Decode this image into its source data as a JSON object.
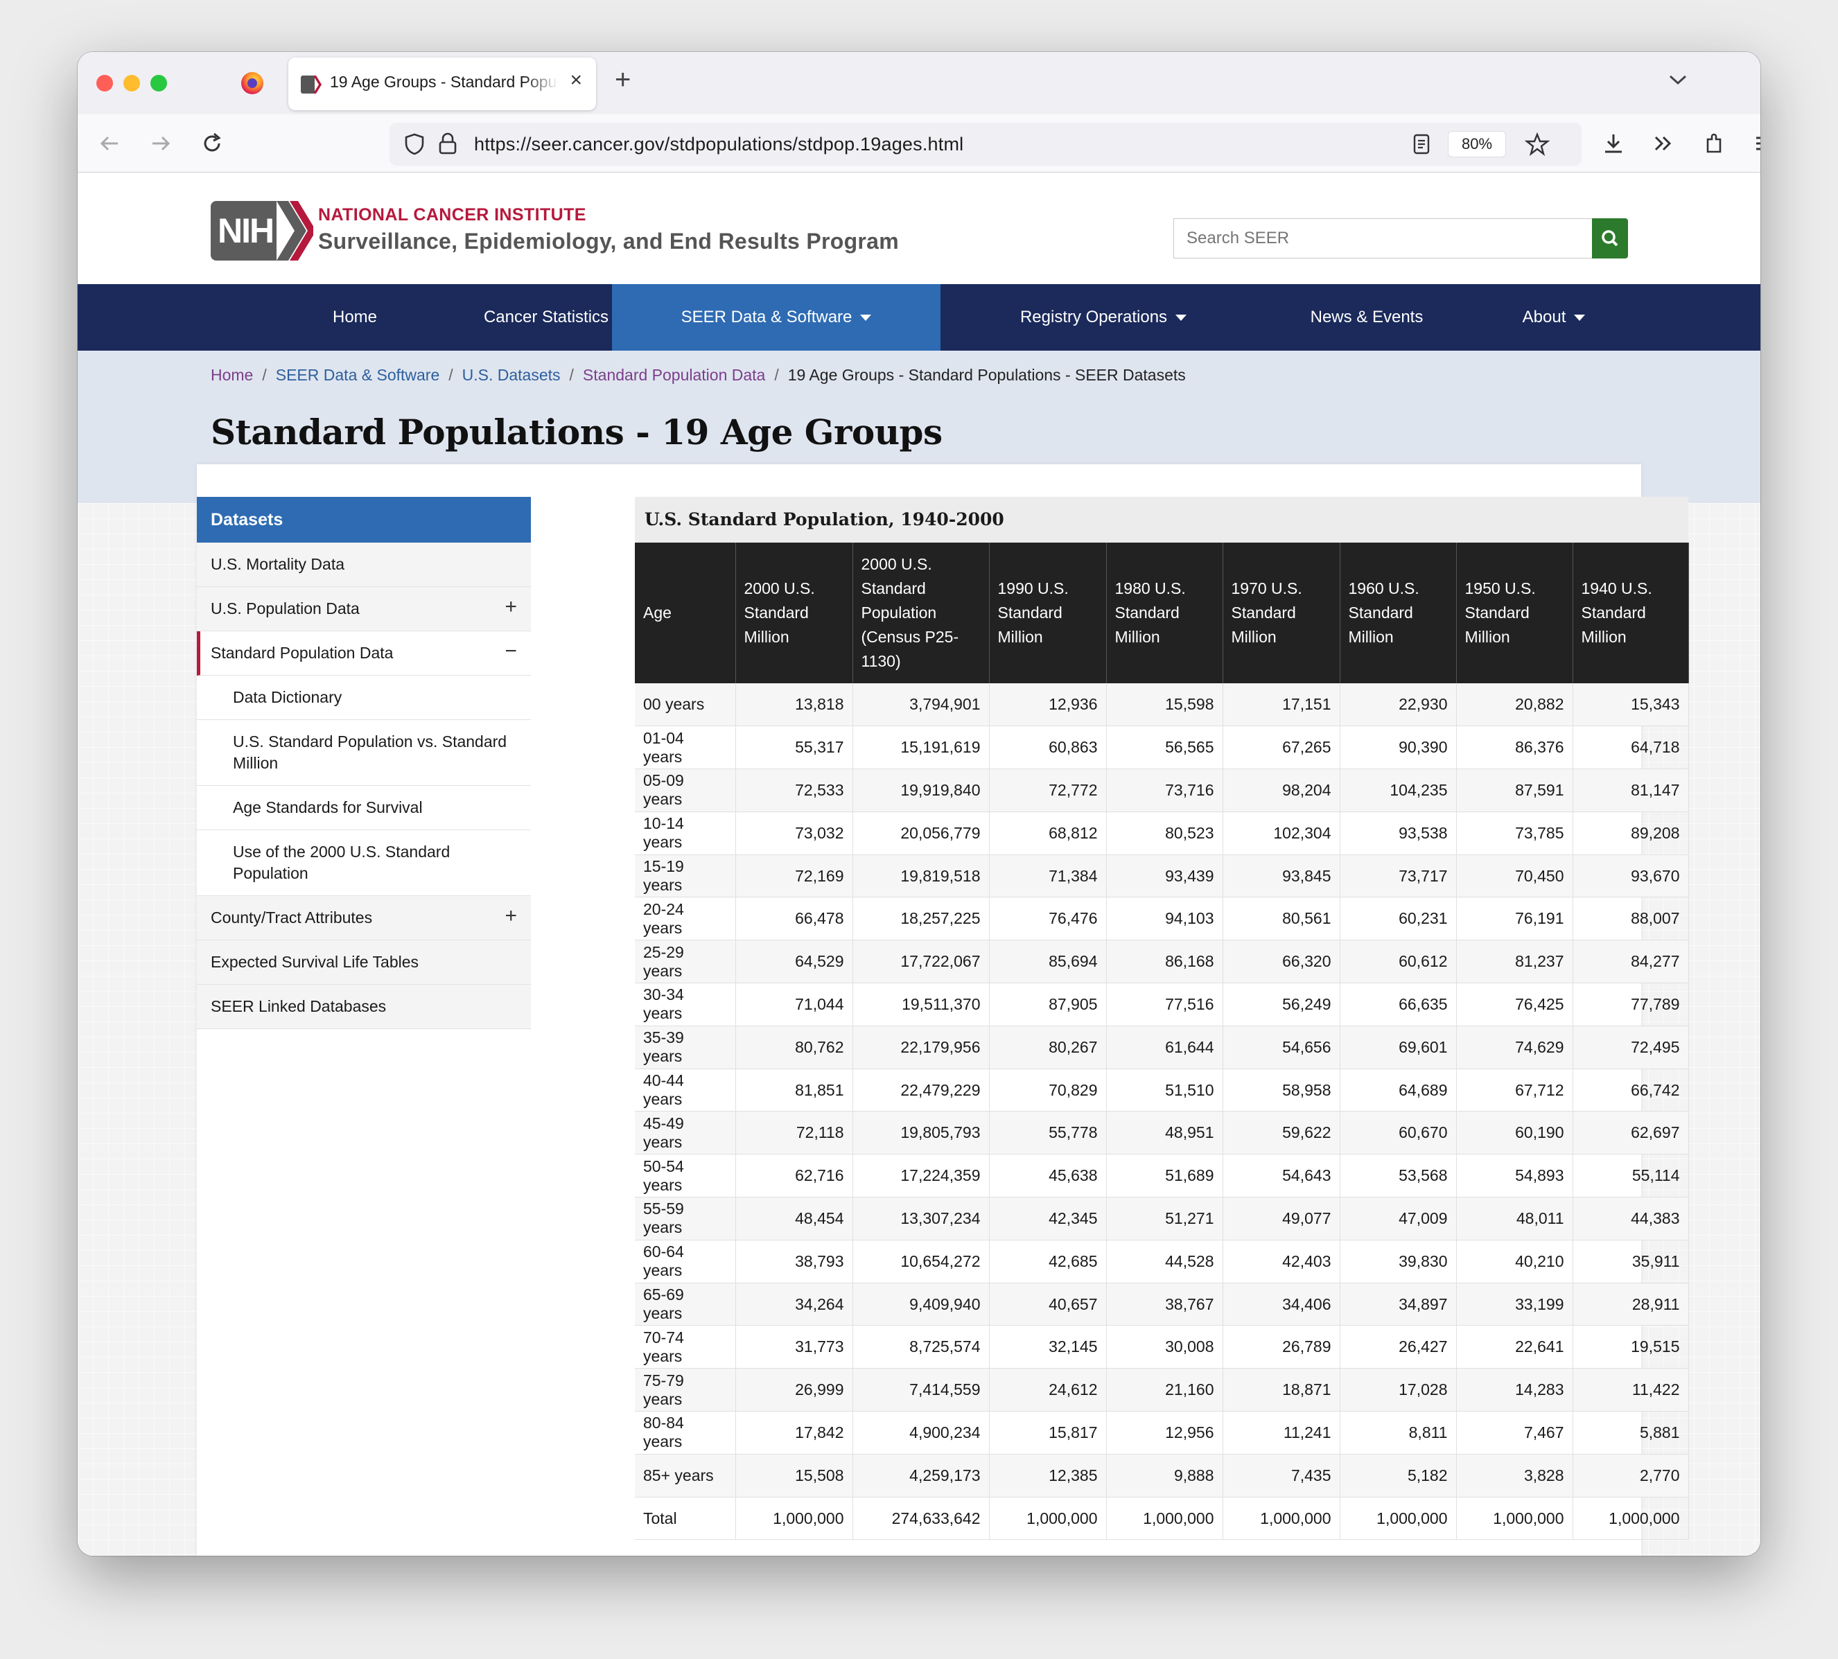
{
  "browser": {
    "tab_title": "19 Age Groups - Standard Populations - SEER Datasets",
    "url": "https://seer.cancer.gov/stdpopulations/stdpop.19ages.html",
    "zoom": "80%"
  },
  "header": {
    "nih": "NIH",
    "institute": "NATIONAL CANCER INSTITUTE",
    "program": "Surveillance, Epidemiology, and End Results Program",
    "search_placeholder": "Search SEER"
  },
  "nav": [
    {
      "label": "Home"
    },
    {
      "label": "Cancer Statistics"
    },
    {
      "label": "SEER Data & Software"
    },
    {
      "label": "Registry Operations"
    },
    {
      "label": "News & Events"
    },
    {
      "label": "About"
    }
  ],
  "breadcrumbs": [
    "Home",
    "SEER Data & Software",
    "U.S. Datasets",
    "Standard Population Data",
    "19 Age Groups - Standard Populations - SEER Datasets"
  ],
  "page_title": "Standard Populations - 19 Age Groups",
  "sidebar": {
    "title": "Datasets",
    "items": [
      "U.S. Mortality Data",
      "U.S. Population Data",
      "Standard Population Data",
      "Data Dictionary",
      "U.S. Standard Population vs. Standard Million",
      "Age Standards for Survival",
      "Use of the 2000 U.S. Standard Population",
      "County/Tract Attributes",
      "Expected Survival Life Tables",
      "SEER Linked Databases"
    ]
  },
  "table": {
    "caption": "U.S. Standard Population, 1940-2000",
    "headers": [
      "Age",
      "2000 U.S. Standard Million",
      "2000 U.S. Standard Population (Census P25-1130)",
      "1990 U.S. Standard Million",
      "1980 U.S. Standard Million",
      "1970 U.S. Standard Million",
      "1960 U.S. Standard Million",
      "1950 U.S. Standard Million",
      "1940 U.S. Standard Million"
    ],
    "rows": [
      [
        "00 years",
        "13,818",
        "3,794,901",
        "12,936",
        "15,598",
        "17,151",
        "22,930",
        "20,882",
        "15,343"
      ],
      [
        "01-04 years",
        "55,317",
        "15,191,619",
        "60,863",
        "56,565",
        "67,265",
        "90,390",
        "86,376",
        "64,718"
      ],
      [
        "05-09 years",
        "72,533",
        "19,919,840",
        "72,772",
        "73,716",
        "98,204",
        "104,235",
        "87,591",
        "81,147"
      ],
      [
        "10-14 years",
        "73,032",
        "20,056,779",
        "68,812",
        "80,523",
        "102,304",
        "93,538",
        "73,785",
        "89,208"
      ],
      [
        "15-19 years",
        "72,169",
        "19,819,518",
        "71,384",
        "93,439",
        "93,845",
        "73,717",
        "70,450",
        "93,670"
      ],
      [
        "20-24 years",
        "66,478",
        "18,257,225",
        "76,476",
        "94,103",
        "80,561",
        "60,231",
        "76,191",
        "88,007"
      ],
      [
        "25-29 years",
        "64,529",
        "17,722,067",
        "85,694",
        "86,168",
        "66,320",
        "60,612",
        "81,237",
        "84,277"
      ],
      [
        "30-34 years",
        "71,044",
        "19,511,370",
        "87,905",
        "77,516",
        "56,249",
        "66,635",
        "76,425",
        "77,789"
      ],
      [
        "35-39 years",
        "80,762",
        "22,179,956",
        "80,267",
        "61,644",
        "54,656",
        "69,601",
        "74,629",
        "72,495"
      ],
      [
        "40-44 years",
        "81,851",
        "22,479,229",
        "70,829",
        "51,510",
        "58,958",
        "64,689",
        "67,712",
        "66,742"
      ],
      [
        "45-49 years",
        "72,118",
        "19,805,793",
        "55,778",
        "48,951",
        "59,622",
        "60,670",
        "60,190",
        "62,697"
      ],
      [
        "50-54 years",
        "62,716",
        "17,224,359",
        "45,638",
        "51,689",
        "54,643",
        "53,568",
        "54,893",
        "55,114"
      ],
      [
        "55-59 years",
        "48,454",
        "13,307,234",
        "42,345",
        "51,271",
        "49,077",
        "47,009",
        "48,011",
        "44,383"
      ],
      [
        "60-64 years",
        "38,793",
        "10,654,272",
        "42,685",
        "44,528",
        "42,403",
        "39,830",
        "40,210",
        "35,911"
      ],
      [
        "65-69 years",
        "34,264",
        "9,409,940",
        "40,657",
        "38,767",
        "34,406",
        "34,897",
        "33,199",
        "28,911"
      ],
      [
        "70-74 years",
        "31,773",
        "8,725,574",
        "32,145",
        "30,008",
        "26,789",
        "26,427",
        "22,641",
        "19,515"
      ],
      [
        "75-79 years",
        "26,999",
        "7,414,559",
        "24,612",
        "21,160",
        "18,871",
        "17,028",
        "14,283",
        "11,422"
      ],
      [
        "80-84 years",
        "17,842",
        "4,900,234",
        "15,817",
        "12,956",
        "11,241",
        "8,811",
        "7,467",
        "5,881"
      ],
      [
        "85+ years",
        "15,508",
        "4,259,173",
        "12,385",
        "9,888",
        "7,435",
        "5,182",
        "3,828",
        "2,770"
      ],
      [
        "Total",
        "1,000,000",
        "274,633,642",
        "1,000,000",
        "1,000,000",
        "1,000,000",
        "1,000,000",
        "1,000,000",
        "1,000,000"
      ]
    ]
  },
  "colors": {
    "nav_bg": "#1b2a5b",
    "nav_active": "#2e6bb3",
    "brand_red": "#b5193c",
    "search_green": "#2c7a2c"
  }
}
